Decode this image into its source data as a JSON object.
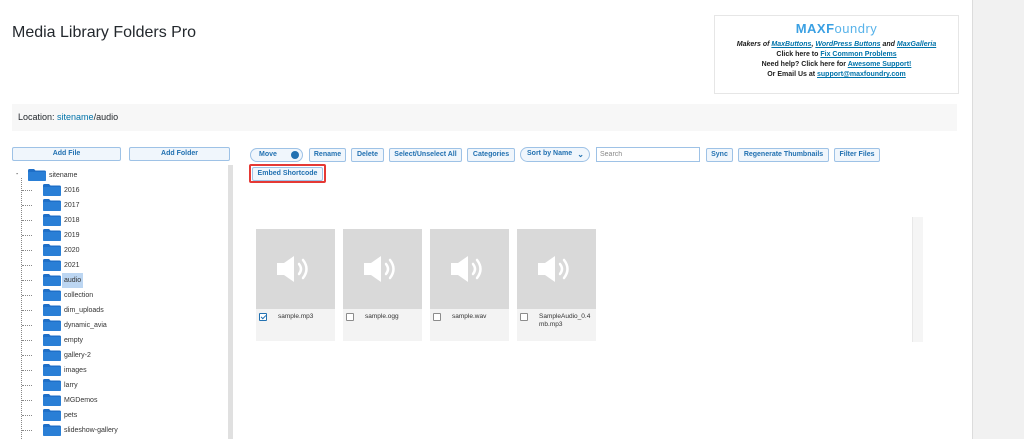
{
  "app": {
    "title": "Media Library Folders Pro"
  },
  "promo": {
    "brand_bold": "MAXF",
    "brand_thin": "oundry",
    "line1_prefix": "Makers of ",
    "line1_link1": "MaxButtons",
    "line1_sep1": ", ",
    "line1_link2": "WordPress Buttons",
    "line1_sep2": " and ",
    "line1_link3": "MaxGalleria",
    "line2_prefix": "Click here to ",
    "line2_link": "Fix Common Problems",
    "line3_prefix": "Need help? Click here for ",
    "line3_link": "Awesome Support!",
    "line4_prefix": "Or Email Us at ",
    "line4_link": "support@maxfoundry.com"
  },
  "location": {
    "label": "Location: ",
    "root_link": "sitename",
    "separator": "/",
    "current": "audio"
  },
  "left_toolbar": {
    "add_file": "Add File",
    "add_folder": "Add Folder"
  },
  "toolbar": {
    "move": "Move",
    "rename": "Rename",
    "delete": "Delete",
    "select_unselect_all": "Select/Unselect All",
    "categories": "Categories",
    "sort": "Sort by Name",
    "search_placeholder": "Search",
    "sync": "Sync",
    "regenerate_thumbnails": "Regenerate Thumbnails",
    "filter_files": "Filter Files",
    "embed_shortcode": "Embed Shortcode"
  },
  "tree": {
    "root": "sitename",
    "root_toggle": "-",
    "folders": [
      {
        "label": "2016"
      },
      {
        "label": "2017"
      },
      {
        "label": "2018"
      },
      {
        "label": "2019"
      },
      {
        "label": "2020"
      },
      {
        "label": "2021"
      },
      {
        "label": "audio",
        "selected": true
      },
      {
        "label": "collection"
      },
      {
        "label": "dim_uploads"
      },
      {
        "label": "dynamic_avia"
      },
      {
        "label": "empty"
      },
      {
        "label": "gallery-2"
      },
      {
        "label": "images"
      },
      {
        "label": "larry"
      },
      {
        "label": "MGDemos"
      },
      {
        "label": "pets"
      },
      {
        "label": "slideshow-gallery"
      }
    ]
  },
  "files": [
    {
      "name": "sample.mp3",
      "checked": true,
      "icon": "audio-icon"
    },
    {
      "name": "sample.ogg",
      "checked": false,
      "icon": "audio-icon"
    },
    {
      "name": "sample.wav",
      "checked": false,
      "icon": "audio-icon"
    },
    {
      "name": "SampleAudio_0.4mb.mp3",
      "checked": false,
      "icon": "audio-icon"
    }
  ],
  "colors": {
    "accent": "#2271b1",
    "folder": "#1e6fc8",
    "highlight": "#e53935"
  }
}
